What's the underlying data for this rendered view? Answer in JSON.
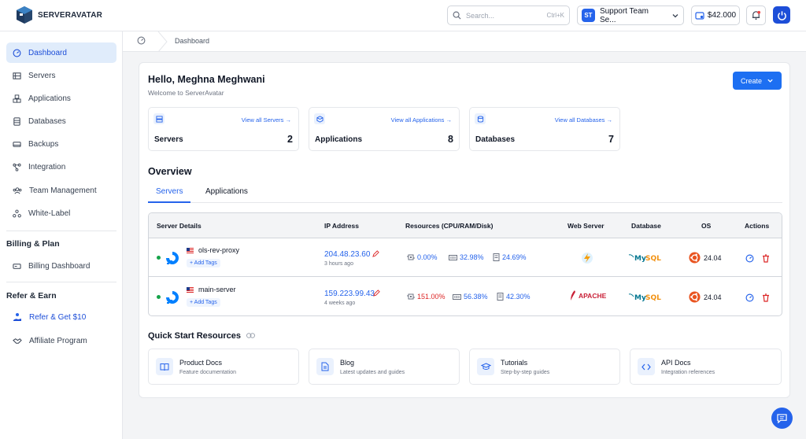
{
  "app": {
    "brand": "SERVERAVATAR"
  },
  "topbar": {
    "search_placeholder": "Search...",
    "search_shortcut": "Ctrl+K",
    "team_initials": "ST",
    "team_name": "Support Team Se...",
    "balance": "$42.000"
  },
  "sidebar": {
    "items": [
      {
        "label": "Dashboard",
        "icon": "gauge-icon"
      },
      {
        "label": "Servers",
        "icon": "server-icon"
      },
      {
        "label": "Applications",
        "icon": "cubes-icon"
      },
      {
        "label": "Databases",
        "icon": "database-icon"
      },
      {
        "label": "Backups",
        "icon": "backup-icon"
      },
      {
        "label": "Integration",
        "icon": "integration-icon"
      },
      {
        "label": "Team Management",
        "icon": "team-icon"
      },
      {
        "label": "White-Label",
        "icon": "white-label-icon"
      }
    ],
    "billing_title": "Billing & Plan",
    "billing_items": [
      {
        "label": "Billing Dashboard",
        "icon": "billing-icon"
      }
    ],
    "refer_title": "Refer & Earn",
    "refer_items": [
      {
        "label": "Refer & Get $10",
        "icon": "refer-icon"
      },
      {
        "label": "Affiliate Program",
        "icon": "handshake-icon"
      }
    ]
  },
  "breadcrumb": {
    "current": "Dashboard"
  },
  "main": {
    "greeting": "Hello, Meghna Meghwani",
    "welcome": "Welcome to ServerAvatar",
    "create_label": "Create",
    "stats": [
      {
        "label": "Servers",
        "count": "2",
        "link": "View all Servers →"
      },
      {
        "label": "Applications",
        "count": "8",
        "link": "View all Applications →"
      },
      {
        "label": "Databases",
        "count": "7",
        "link": "View all Databases →"
      }
    ],
    "overview_title": "Overview",
    "tabs": [
      "Servers",
      "Applications"
    ],
    "table": {
      "headers": [
        "Server Details",
        "IP Address",
        "Resources (CPU/RAM/Disk)",
        "Web Server",
        "Database",
        "OS",
        "Actions"
      ],
      "add_tags": "+ Add Tags",
      "rows": [
        {
          "name": "ols-rev-proxy",
          "ip": "204.48.23.60",
          "ago": "3 hours ago",
          "cpu": "0.00%",
          "ram": "32.98%",
          "disk": "24.69%",
          "cpu_color": "#2563eb",
          "web_server": "",
          "database": "MySQL",
          "os": "24.04"
        },
        {
          "name": "main-server",
          "ip": "159.223.99.43",
          "ago": "4 weeks ago",
          "cpu": "151.00%",
          "ram": "56.38%",
          "disk": "42.30%",
          "cpu_color": "#dc2626",
          "web_server": "APACHE",
          "database": "MySQL",
          "os": "24.04"
        }
      ]
    },
    "quick_start_title": "Quick Start Resources",
    "quick_start": [
      {
        "title": "Product Docs",
        "subtitle": "Feature documentation",
        "icon": "book-icon"
      },
      {
        "title": "Blog",
        "subtitle": "Latest updates and guides",
        "icon": "document-icon"
      },
      {
        "title": "Tutorials",
        "subtitle": "Step-by-step guides",
        "icon": "graduation-icon"
      },
      {
        "title": "API Docs",
        "subtitle": "Integration references",
        "icon": "code-icon"
      }
    ]
  },
  "colors": {
    "accent": "#2563eb",
    "active_bg": "#e0ecfb",
    "danger": "#dc2626",
    "success": "#16a34a"
  }
}
